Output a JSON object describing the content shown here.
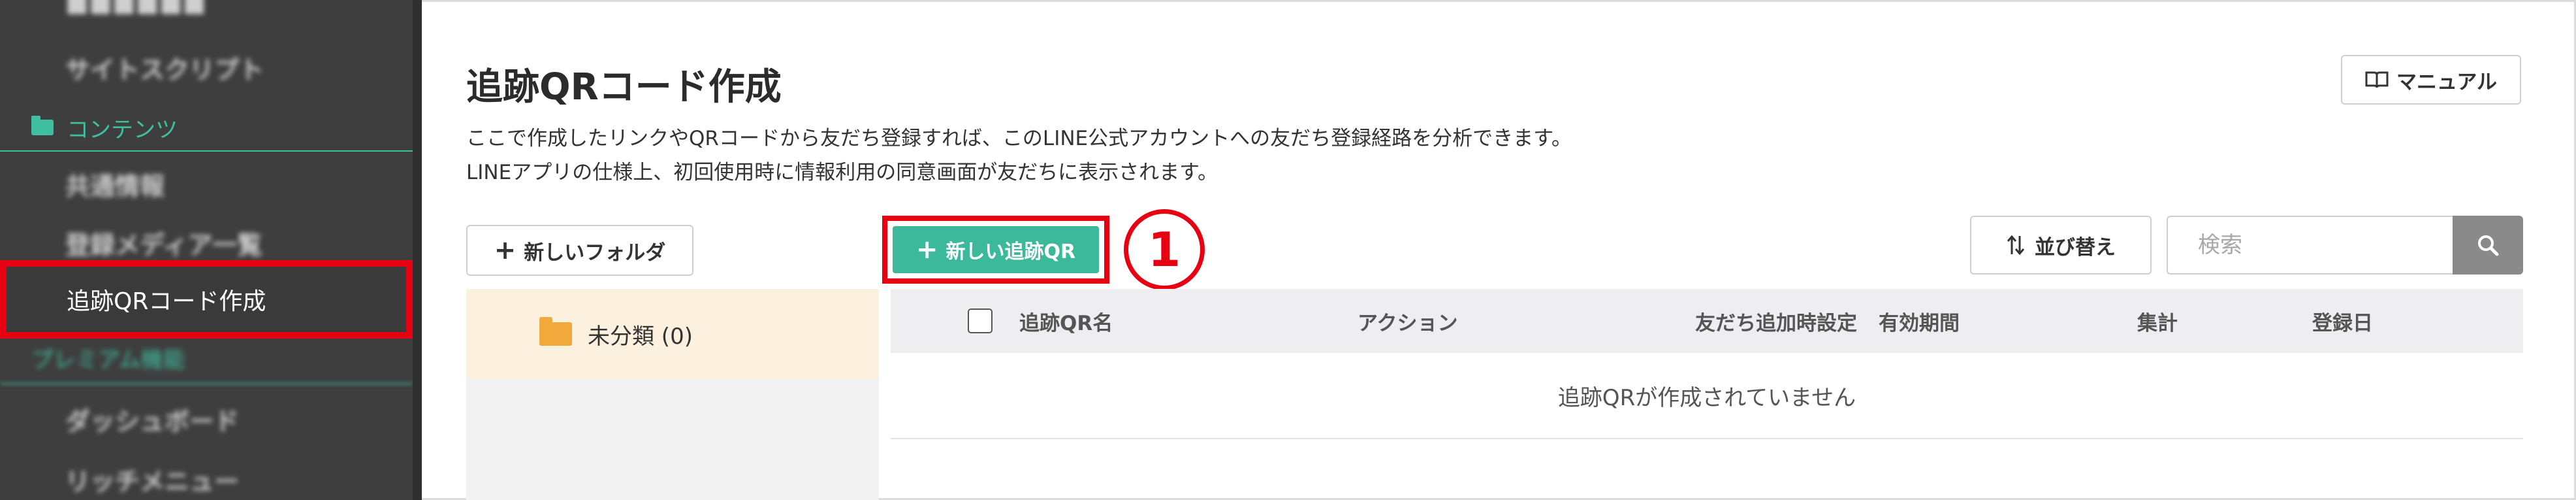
{
  "sidebar": {
    "items_top": [
      "サイトスクリプト"
    ],
    "section_contents": "コンテンツ",
    "items_contents": [
      "共通情報",
      "登録メディア一覧"
    ],
    "active_item": "追跡QRコード作成",
    "section_premium": "プレミアム機能",
    "items_bottom": [
      "ダッシュボード",
      "リッチメニュー"
    ]
  },
  "header": {
    "title": "追跡QRコード作成",
    "description_line1": "ここで作成したリンクやQRコードから友だち登録すれば、このLINE公式アカウントへの友だち登録経路を分析できます。",
    "description_line2": "LINEアプリの仕様上、初回使用時に情報利用の同意画面が友だちに表示されます。",
    "manual_label": "マニュアル"
  },
  "toolbar": {
    "new_folder_label": "新しいフォルダ",
    "new_qr_label": "新しい追跡QR",
    "step_number": "①",
    "sort_label": "並び替え",
    "search_placeholder": "検索"
  },
  "folders": [
    {
      "label": "未分類 (0)"
    }
  ],
  "table": {
    "columns": [
      "追跡QR名",
      "アクション",
      "友だち追加時設定",
      "有効期間",
      "集計",
      "登録日"
    ],
    "empty_message": "追跡QRが作成されていません"
  },
  "colors": {
    "accent": "#3cb89a",
    "highlight": "#e60012",
    "folder": "#f2a93b",
    "sidebar_bg": "#3e3e3e"
  }
}
